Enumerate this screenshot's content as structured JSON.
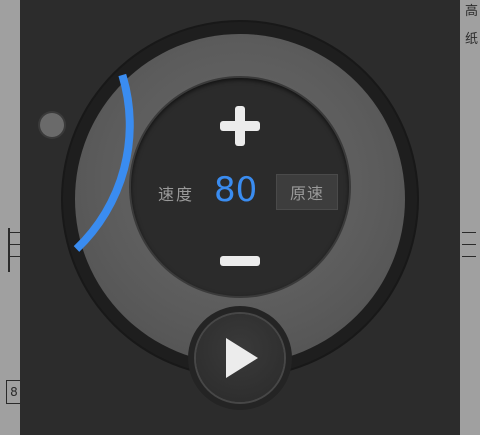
{
  "background": {
    "edge_right_top": "高",
    "edge_right_second": "纸",
    "edge_left_box": "8"
  },
  "metronome": {
    "speed_label": "速度",
    "speed_value": "80",
    "reset_label": "原速",
    "progress_fraction": 0.2,
    "accent_color": "#3a8cf0",
    "icons": {
      "increase": "plus-icon",
      "decrease": "minus-icon",
      "play": "play-icon"
    }
  }
}
